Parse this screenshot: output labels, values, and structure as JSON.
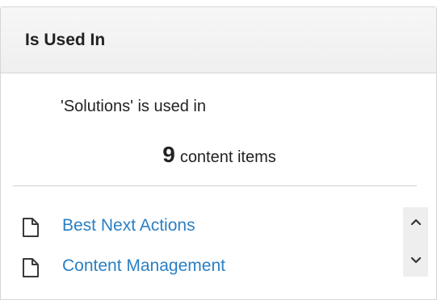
{
  "panel": {
    "title": "Is Used In",
    "summary": "'Solutions' is used in",
    "count": "9",
    "count_label": "content items",
    "items": [
      {
        "label": "Best Next Actions",
        "icon": "document-icon"
      },
      {
        "label": "Content Management",
        "icon": "document-icon"
      }
    ]
  },
  "colors": {
    "link": "#2a7fc4",
    "text": "#222222",
    "border": "#d6d6d6",
    "header_bg": "#f3f3f3",
    "scrollbar_bg": "#eeeeee"
  },
  "icons": {
    "scroll_up": "chevron-up-icon",
    "scroll_down": "chevron-down-icon"
  }
}
